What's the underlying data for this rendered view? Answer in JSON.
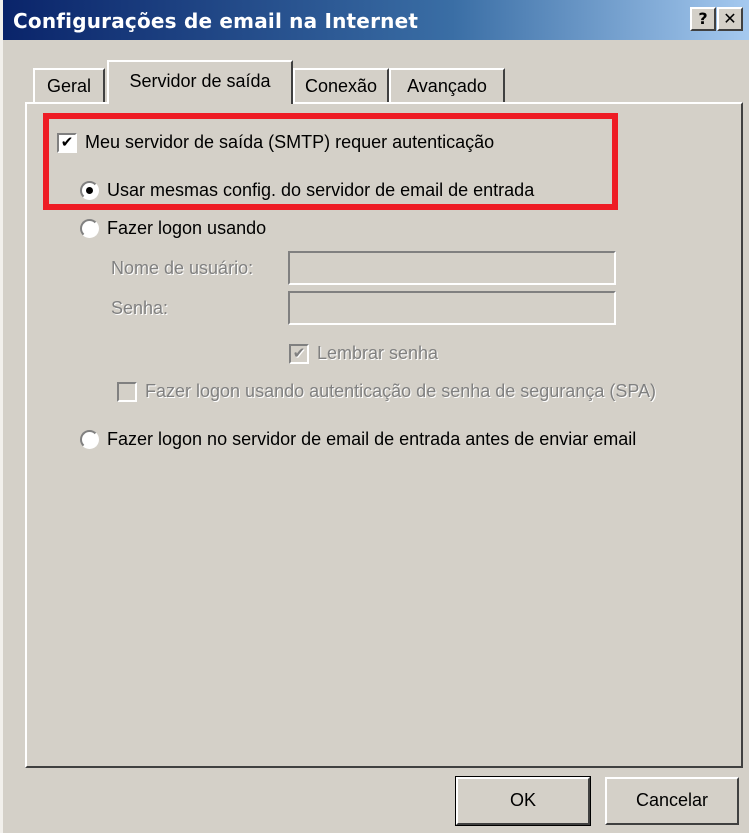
{
  "window": {
    "title": "Configurações de email na Internet",
    "help_label": "?",
    "close_label": "✕"
  },
  "tabs": [
    {
      "label": "Geral",
      "selected": false
    },
    {
      "label": "Servidor de saída",
      "selected": true
    },
    {
      "label": "Conexão",
      "selected": false
    },
    {
      "label": "Avançado",
      "selected": false
    }
  ],
  "smtp_auth": {
    "label": "Meu servidor de saída (SMTP) requer autenticação",
    "checked": true
  },
  "options": {
    "same_config_label": "Usar mesmas config. do servidor de email de entrada",
    "same_config_selected": true,
    "logon_using_label": "Fazer logon usando",
    "logon_using_selected": false,
    "username_label": "Nome de usuário:",
    "username_value": "",
    "password_label": "Senha:",
    "password_value": "",
    "remember_password_label": "Lembrar senha",
    "remember_password_checked": true,
    "spa_label": "Fazer logon usando autenticação de senha de segurança (SPA)",
    "spa_checked": false,
    "pop_before_smtp_label": "Fazer logon no servidor de email de entrada antes de enviar email",
    "pop_before_smtp_selected": false
  },
  "buttons": {
    "ok_label": "OK",
    "cancel_label": "Cancelar"
  },
  "colors": {
    "highlight": "#ee1c25",
    "titlebar_start": "#0a246a",
    "titlebar_end": "#a6caf0",
    "face": "#d4d0c8"
  }
}
